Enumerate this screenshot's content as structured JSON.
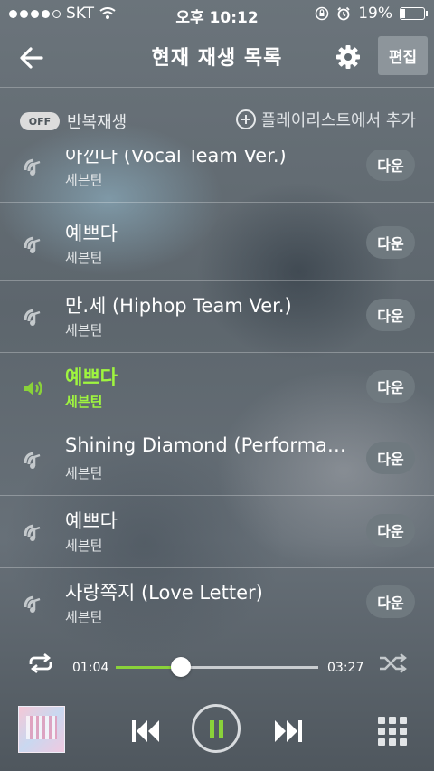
{
  "status": {
    "carrier": "SKT",
    "time": "오후 10:12",
    "battery": "19%"
  },
  "header": {
    "title": "현재 재생 목록",
    "edit_label": "편집"
  },
  "toolbar": {
    "toggle_label": "OFF",
    "repeat_label": "반복재생",
    "add_playlist_label": "플레이리스트에서 추가"
  },
  "tracks": [
    {
      "title": "아낀다 (Vocal Team Ver.)",
      "artist": "세븐틴",
      "button": "다운",
      "playing": false
    },
    {
      "title": "예쁘다",
      "artist": "세븐틴",
      "button": "다운",
      "playing": false
    },
    {
      "title": "만.세 (Hiphop Team Ver.)",
      "artist": "세븐틴",
      "button": "다운",
      "playing": false
    },
    {
      "title": "예쁘다",
      "artist": "세븐틴",
      "button": "다운",
      "playing": true
    },
    {
      "title": "Shining Diamond (Performance Team Ver.)",
      "artist": "세븐틴",
      "button": "다운",
      "playing": false
    },
    {
      "title": "예쁘다",
      "artist": "세븐틴",
      "button": "다운",
      "playing": false
    },
    {
      "title": "사랑쪽지 (Love Letter)",
      "artist": "세븐틴",
      "button": "다운",
      "playing": false
    }
  ],
  "progress": {
    "current": "01:04",
    "total": "03:27",
    "fraction": 0.32
  },
  "colors": {
    "accent": "#8ad23a",
    "active_text": "#9ff53f"
  },
  "icons": {
    "back": "arrow-left",
    "settings": "gear",
    "repeat": "repeat-arrows",
    "shuffle": "shuffle-arrows",
    "previous": "skip-previous",
    "pause": "pause",
    "next": "skip-next",
    "menu": "grid-menu"
  }
}
